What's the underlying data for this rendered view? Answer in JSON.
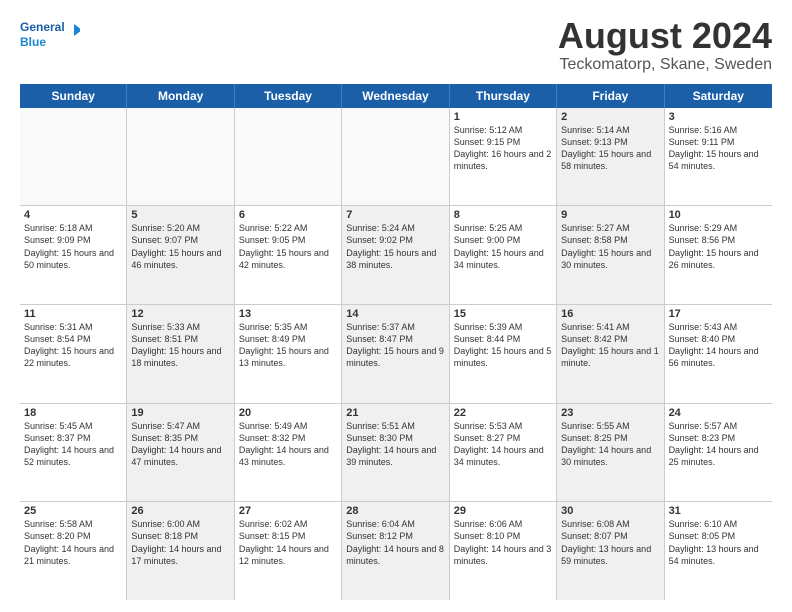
{
  "header": {
    "logo_general": "General",
    "logo_blue": "Blue",
    "month_year": "August 2024",
    "location": "Teckomatorp, Skane, Sweden"
  },
  "days_of_week": [
    "Sunday",
    "Monday",
    "Tuesday",
    "Wednesday",
    "Thursday",
    "Friday",
    "Saturday"
  ],
  "weeks": [
    [
      {
        "day": "",
        "info": "",
        "shade": true
      },
      {
        "day": "",
        "info": "",
        "shade": true
      },
      {
        "day": "",
        "info": "",
        "shade": true
      },
      {
        "day": "",
        "info": "",
        "shade": true
      },
      {
        "day": "1",
        "info": "Sunrise: 5:12 AM\nSunset: 9:15 PM\nDaylight: 16 hours and 2 minutes.",
        "shade": false
      },
      {
        "day": "2",
        "info": "Sunrise: 5:14 AM\nSunset: 9:13 PM\nDaylight: 15 hours and 58 minutes.",
        "shade": true
      },
      {
        "day": "3",
        "info": "Sunrise: 5:16 AM\nSunset: 9:11 PM\nDaylight: 15 hours and 54 minutes.",
        "shade": false
      }
    ],
    [
      {
        "day": "4",
        "info": "Sunrise: 5:18 AM\nSunset: 9:09 PM\nDaylight: 15 hours and 50 minutes.",
        "shade": false
      },
      {
        "day": "5",
        "info": "Sunrise: 5:20 AM\nSunset: 9:07 PM\nDaylight: 15 hours and 46 minutes.",
        "shade": true
      },
      {
        "day": "6",
        "info": "Sunrise: 5:22 AM\nSunset: 9:05 PM\nDaylight: 15 hours and 42 minutes.",
        "shade": false
      },
      {
        "day": "7",
        "info": "Sunrise: 5:24 AM\nSunset: 9:02 PM\nDaylight: 15 hours and 38 minutes.",
        "shade": true
      },
      {
        "day": "8",
        "info": "Sunrise: 5:25 AM\nSunset: 9:00 PM\nDaylight: 15 hours and 34 minutes.",
        "shade": false
      },
      {
        "day": "9",
        "info": "Sunrise: 5:27 AM\nSunset: 8:58 PM\nDaylight: 15 hours and 30 minutes.",
        "shade": true
      },
      {
        "day": "10",
        "info": "Sunrise: 5:29 AM\nSunset: 8:56 PM\nDaylight: 15 hours and 26 minutes.",
        "shade": false
      }
    ],
    [
      {
        "day": "11",
        "info": "Sunrise: 5:31 AM\nSunset: 8:54 PM\nDaylight: 15 hours and 22 minutes.",
        "shade": false
      },
      {
        "day": "12",
        "info": "Sunrise: 5:33 AM\nSunset: 8:51 PM\nDaylight: 15 hours and 18 minutes.",
        "shade": true
      },
      {
        "day": "13",
        "info": "Sunrise: 5:35 AM\nSunset: 8:49 PM\nDaylight: 15 hours and 13 minutes.",
        "shade": false
      },
      {
        "day": "14",
        "info": "Sunrise: 5:37 AM\nSunset: 8:47 PM\nDaylight: 15 hours and 9 minutes.",
        "shade": true
      },
      {
        "day": "15",
        "info": "Sunrise: 5:39 AM\nSunset: 8:44 PM\nDaylight: 15 hours and 5 minutes.",
        "shade": false
      },
      {
        "day": "16",
        "info": "Sunrise: 5:41 AM\nSunset: 8:42 PM\nDaylight: 15 hours and 1 minute.",
        "shade": true
      },
      {
        "day": "17",
        "info": "Sunrise: 5:43 AM\nSunset: 8:40 PM\nDaylight: 14 hours and 56 minutes.",
        "shade": false
      }
    ],
    [
      {
        "day": "18",
        "info": "Sunrise: 5:45 AM\nSunset: 8:37 PM\nDaylight: 14 hours and 52 minutes.",
        "shade": false
      },
      {
        "day": "19",
        "info": "Sunrise: 5:47 AM\nSunset: 8:35 PM\nDaylight: 14 hours and 47 minutes.",
        "shade": true
      },
      {
        "day": "20",
        "info": "Sunrise: 5:49 AM\nSunset: 8:32 PM\nDaylight: 14 hours and 43 minutes.",
        "shade": false
      },
      {
        "day": "21",
        "info": "Sunrise: 5:51 AM\nSunset: 8:30 PM\nDaylight: 14 hours and 39 minutes.",
        "shade": true
      },
      {
        "day": "22",
        "info": "Sunrise: 5:53 AM\nSunset: 8:27 PM\nDaylight: 14 hours and 34 minutes.",
        "shade": false
      },
      {
        "day": "23",
        "info": "Sunrise: 5:55 AM\nSunset: 8:25 PM\nDaylight: 14 hours and 30 minutes.",
        "shade": true
      },
      {
        "day": "24",
        "info": "Sunrise: 5:57 AM\nSunset: 8:23 PM\nDaylight: 14 hours and 25 minutes.",
        "shade": false
      }
    ],
    [
      {
        "day": "25",
        "info": "Sunrise: 5:58 AM\nSunset: 8:20 PM\nDaylight: 14 hours and 21 minutes.",
        "shade": false
      },
      {
        "day": "26",
        "info": "Sunrise: 6:00 AM\nSunset: 8:18 PM\nDaylight: 14 hours and 17 minutes.",
        "shade": true
      },
      {
        "day": "27",
        "info": "Sunrise: 6:02 AM\nSunset: 8:15 PM\nDaylight: 14 hours and 12 minutes.",
        "shade": false
      },
      {
        "day": "28",
        "info": "Sunrise: 6:04 AM\nSunset: 8:12 PM\nDaylight: 14 hours and 8 minutes.",
        "shade": true
      },
      {
        "day": "29",
        "info": "Sunrise: 6:06 AM\nSunset: 8:10 PM\nDaylight: 14 hours and 3 minutes.",
        "shade": false
      },
      {
        "day": "30",
        "info": "Sunrise: 6:08 AM\nSunset: 8:07 PM\nDaylight: 13 hours and 59 minutes.",
        "shade": true
      },
      {
        "day": "31",
        "info": "Sunrise: 6:10 AM\nSunset: 8:05 PM\nDaylight: 13 hours and 54 minutes.",
        "shade": false
      }
    ]
  ]
}
